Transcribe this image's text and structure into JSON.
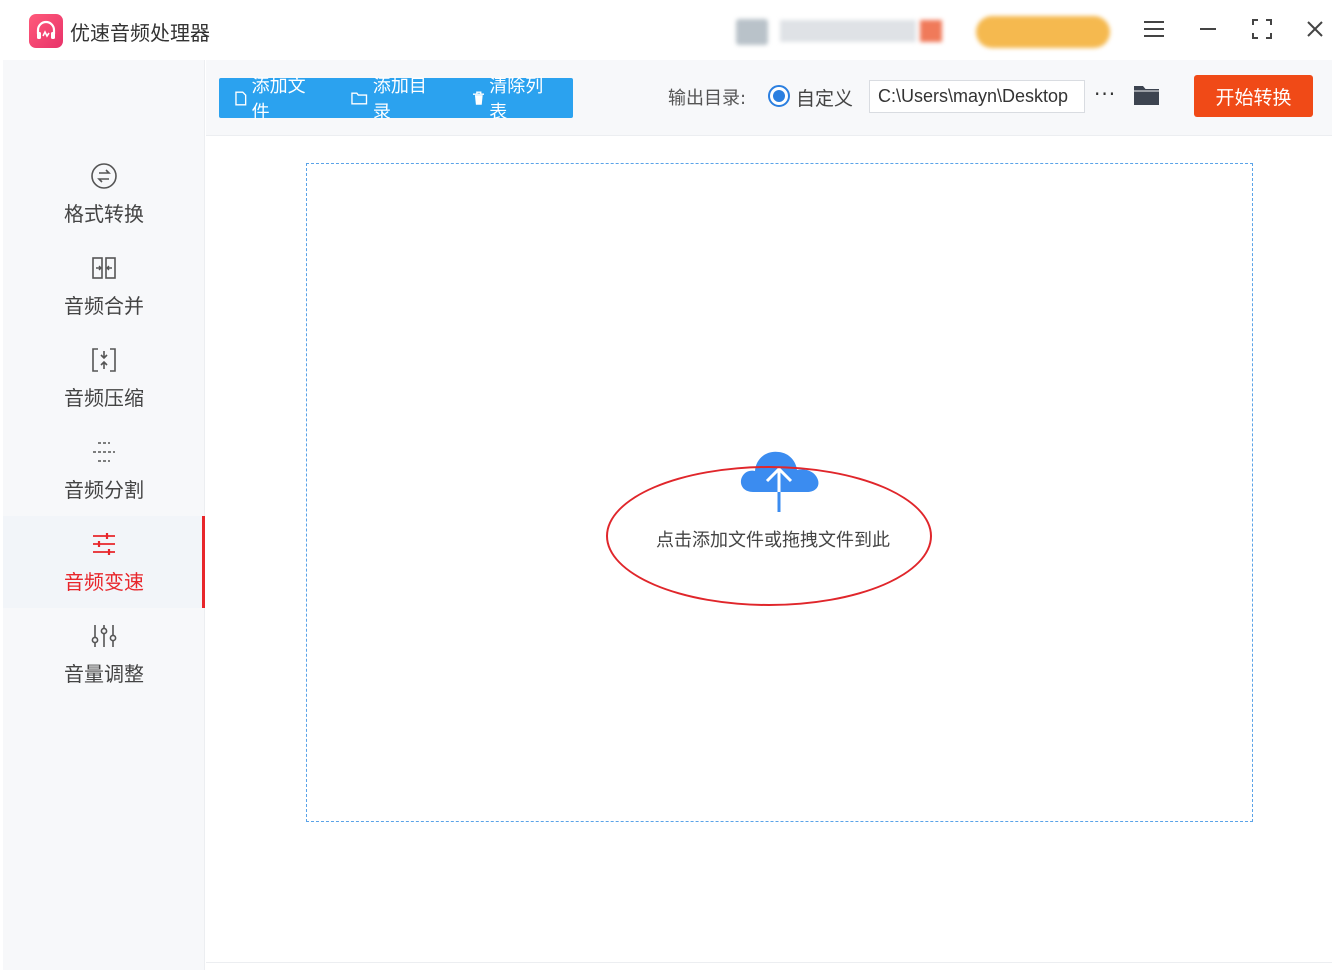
{
  "app": {
    "title": "优速音频处理器"
  },
  "sidebar": {
    "items": [
      {
        "label": "格式转换",
        "icon": "format-convert-icon",
        "active": false
      },
      {
        "label": "音频合并",
        "icon": "merge-icon",
        "active": false
      },
      {
        "label": "音频压缩",
        "icon": "compress-icon",
        "active": false
      },
      {
        "label": "音频分割",
        "icon": "split-icon",
        "active": false
      },
      {
        "label": "音频变速",
        "icon": "speed-sliders-icon",
        "active": true
      },
      {
        "label": "音量调整",
        "icon": "volume-adjust-icon",
        "active": false
      }
    ]
  },
  "toolbar": {
    "add_file": "添加文件",
    "add_dir": "添加目录",
    "clear_list": "清除列表",
    "output_label": "输出目录:",
    "custom_option": "自定义",
    "output_path": "C:\\Users\\mayn\\Desktop",
    "more": "···",
    "start": "开始转换"
  },
  "drop_zone": {
    "text": "点击添加文件或拖拽文件到此"
  },
  "colors": {
    "accent_blue": "#2ba2ef",
    "start_orange": "#f04a17",
    "active_red": "#e8262b",
    "annotation_red": "#e0262b"
  }
}
